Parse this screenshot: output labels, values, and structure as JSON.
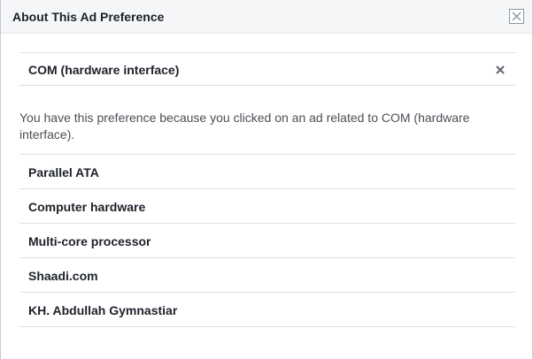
{
  "dialog": {
    "title": "About This Ad Preference",
    "close_icon": "close-icon"
  },
  "preference": {
    "topic": "COM (hardware interface)",
    "remove_icon": "x-icon",
    "description": "You have this preference because you clicked on an ad related to COM (hardware interface)."
  },
  "related": {
    "items": [
      {
        "label": "Parallel ATA"
      },
      {
        "label": "Computer hardware"
      },
      {
        "label": "Multi-core processor"
      },
      {
        "label": "Shaadi.com"
      },
      {
        "label": "KH. Abdullah Gymnastiar"
      }
    ]
  },
  "colors": {
    "header_bg": "#f5f6f7",
    "divider": "#dddfe2",
    "text_primary": "#1d2129",
    "text_secondary": "#4b4f56"
  }
}
